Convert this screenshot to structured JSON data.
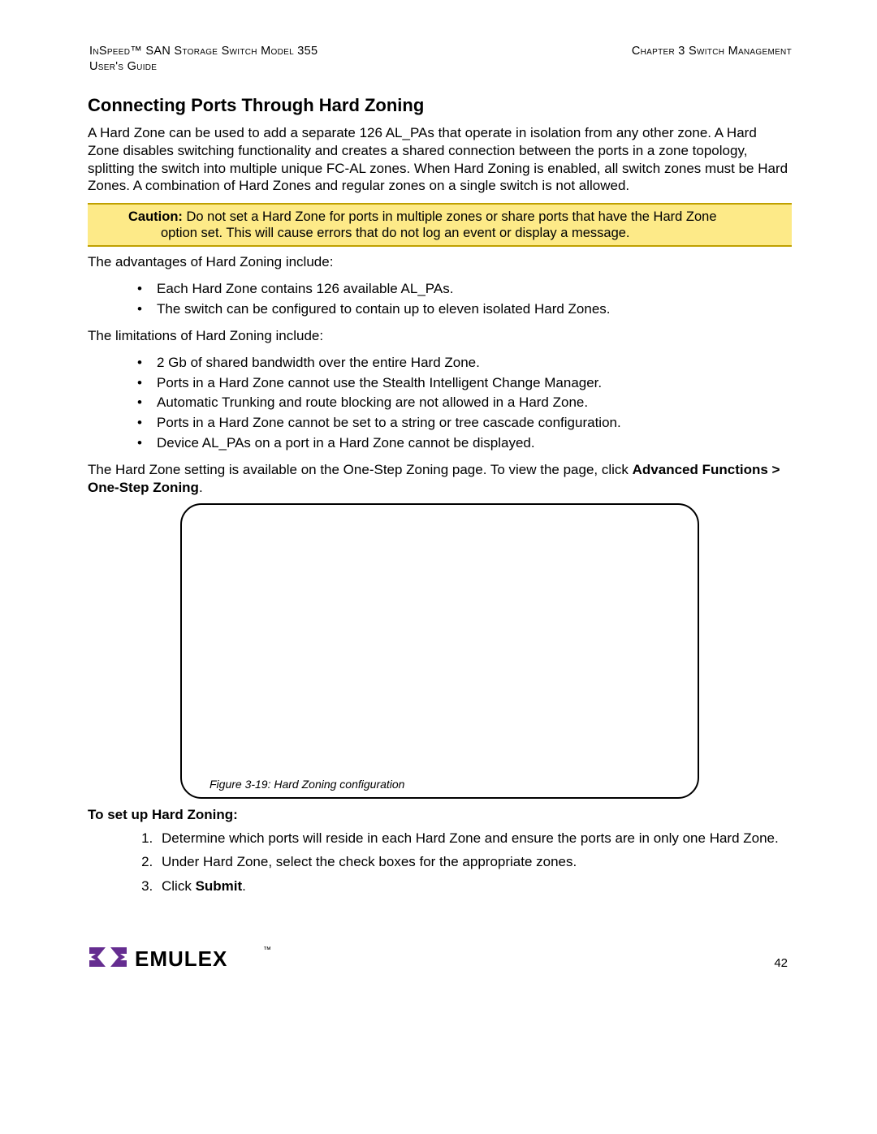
{
  "header": {
    "left_line1_smallcaps": "InSpeed™ SAN Storage Switch Model 355",
    "left_line2_smallcaps": "User's Guide",
    "right_smallcaps": "Chapter 3 Switch Management"
  },
  "title": "Connecting Ports Through Hard Zoning",
  "intro_paragraph": "A Hard Zone can be used to add a separate 126 AL_PAs that operate in isolation from any other zone. A Hard Zone disables switching functionality and creates a shared connection between the ports in a zone topology, splitting the switch into multiple unique FC-AL zones. When Hard Zoning is enabled, all switch zones must be Hard Zones. A combination of Hard Zones and regular zones on a single switch is not allowed.",
  "caution": {
    "label": "Caution:",
    "line1": " Do not set a Hard Zone for ports in multiple zones or share ports that have the Hard Zone",
    "line2": "option set. This will cause errors that do not log an event or display a message."
  },
  "advantages_lead": "The advantages of Hard Zoning include:",
  "advantages": [
    "Each Hard Zone contains 126 available AL_PAs.",
    "The switch can be configured to contain up to eleven isolated Hard Zones."
  ],
  "limitations_lead": "The limitations of Hard Zoning include:",
  "limitations": [
    "2 Gb of shared bandwidth over the entire Hard Zone.",
    "Ports in a Hard Zone cannot use the Stealth Intelligent Change Manager.",
    "Automatic Trunking and route blocking are not allowed in a Hard Zone.",
    "Ports in a Hard Zone cannot be set to a string or tree cascade configuration.",
    "Device AL_PAs on a port in a Hard Zone cannot be displayed."
  ],
  "navpath": {
    "prefix": "The Hard Zone setting is available on the One-Step Zoning page. To view the page, click ",
    "bold": "Advanced Functions > One-Step Zoning",
    "suffix": "."
  },
  "figure_caption": "Figure 3-19: Hard Zoning configuration",
  "setup_header": "To set up Hard Zoning:",
  "setup_steps": [
    {
      "text": "Determine which ports will reside in each Hard Zone and ensure the ports are in only one Hard Zone."
    },
    {
      "text": "Under Hard Zone, select the check boxes for the appropriate zones."
    },
    {
      "prefix": "Click ",
      "bold": "Submit",
      "suffix": "."
    }
  ],
  "logo_text": "EMULEX",
  "page_number": "42"
}
